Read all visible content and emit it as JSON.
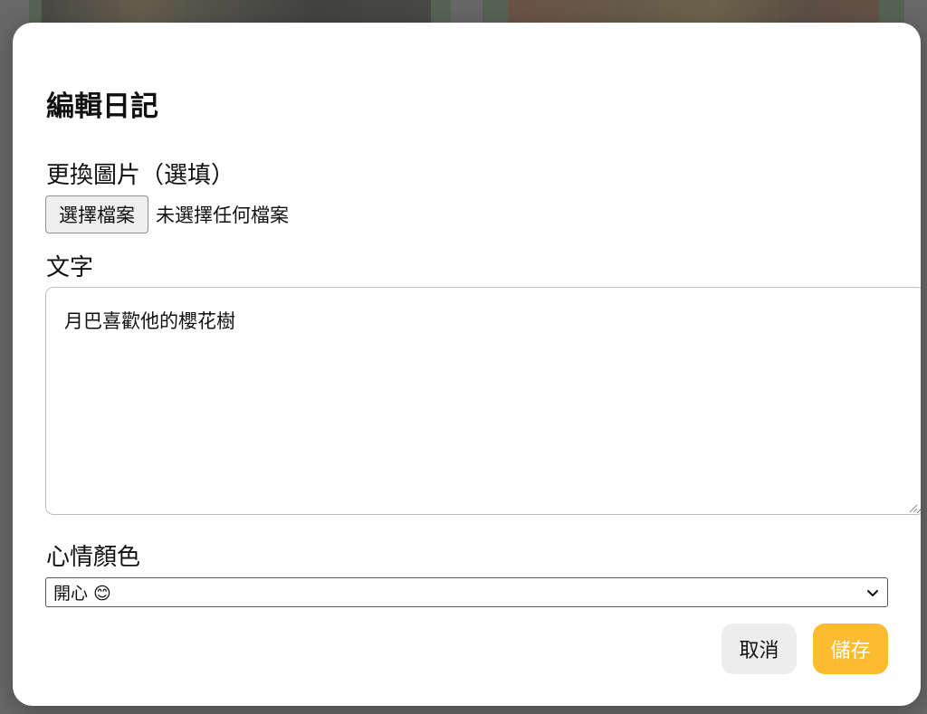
{
  "modal": {
    "title": "編輯日記",
    "image_field": {
      "label": "更換圖片（選填）",
      "button_label": "選擇檔案",
      "status": "未選擇任何檔案"
    },
    "text_field": {
      "label": "文字",
      "value": "月巴喜歡他的櫻花樹"
    },
    "mood_field": {
      "label": "心情顏色",
      "selected": "開心 😊"
    },
    "actions": {
      "cancel_label": "取消",
      "save_label": "儲存"
    }
  },
  "colors": {
    "save_button": "#fbbd2f",
    "cancel_button": "#ededed",
    "overlay": "#6f7170"
  }
}
